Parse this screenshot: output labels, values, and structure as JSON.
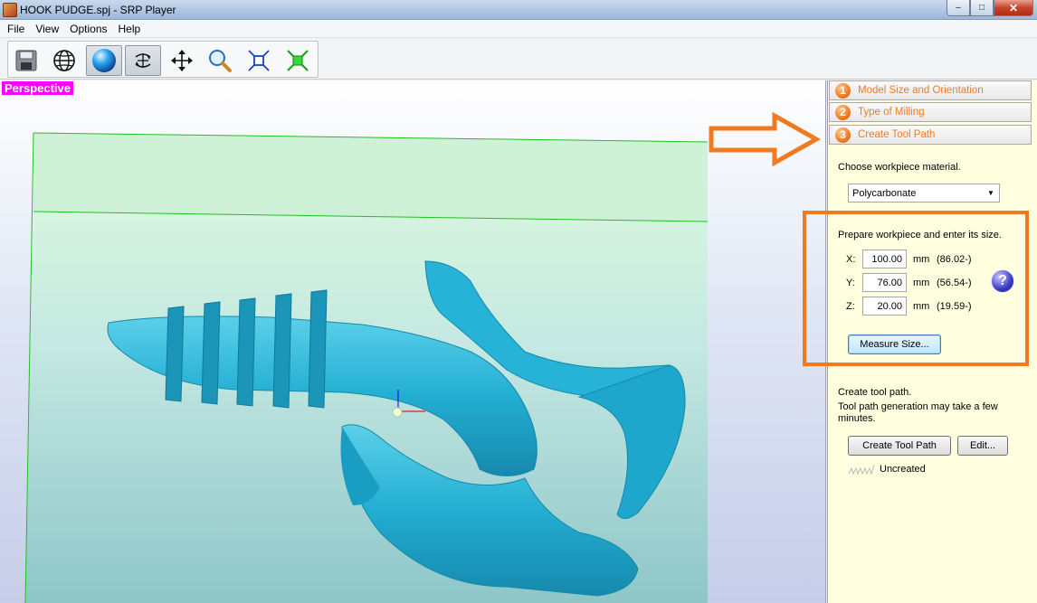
{
  "window": {
    "title": "HOOK PUDGE.spj - SRP Player",
    "buttons": {
      "minimize": "–",
      "maximize": "□",
      "close": "✕"
    }
  },
  "menu": {
    "items": [
      "File",
      "View",
      "Options",
      "Help"
    ]
  },
  "toolbar": {
    "buttons": [
      {
        "name": "save-icon"
      },
      {
        "name": "globe-icon"
      },
      {
        "name": "shaded-sphere-icon",
        "pressed": true
      },
      {
        "name": "rotate-icon",
        "pressed": true
      },
      {
        "name": "move-icon"
      },
      {
        "name": "zoom-icon"
      },
      {
        "name": "fit-view-icon"
      },
      {
        "name": "center-icon"
      }
    ]
  },
  "viewport": {
    "mode_label": "Perspective"
  },
  "panel": {
    "steps": [
      {
        "number": "1",
        "label": "Model Size and Orientation"
      },
      {
        "number": "2",
        "label": "Type of Milling"
      },
      {
        "number": "3",
        "label": "Create Tool Path"
      }
    ],
    "material_prompt": "Choose workpiece material.",
    "material_selected": "Polycarbonate",
    "size_prompt": "Prepare workpiece and enter its size.",
    "dimensions": [
      {
        "axis": "X:",
        "value": "100.00",
        "unit": "mm",
        "measured": "(86.02-)"
      },
      {
        "axis": "Y:",
        "value": "76.00",
        "unit": "mm",
        "measured": "(56.54-)"
      },
      {
        "axis": "Z:",
        "value": "20.00",
        "unit": "mm",
        "measured": "(19.59-)"
      }
    ],
    "help_symbol": "?",
    "measure_button": "Measure Size...",
    "toolpath_title": "Create tool path.",
    "toolpath_note": "Tool path generation may take a few minutes.",
    "create_button": "Create Tool Path",
    "edit_button": "Edit...",
    "status": "Uncreated"
  },
  "colors": {
    "annotation": "#f07a20",
    "perspective_badge": "#ff00ff",
    "model": "#2ab3d6",
    "panel_bg": "#ffffe0"
  }
}
